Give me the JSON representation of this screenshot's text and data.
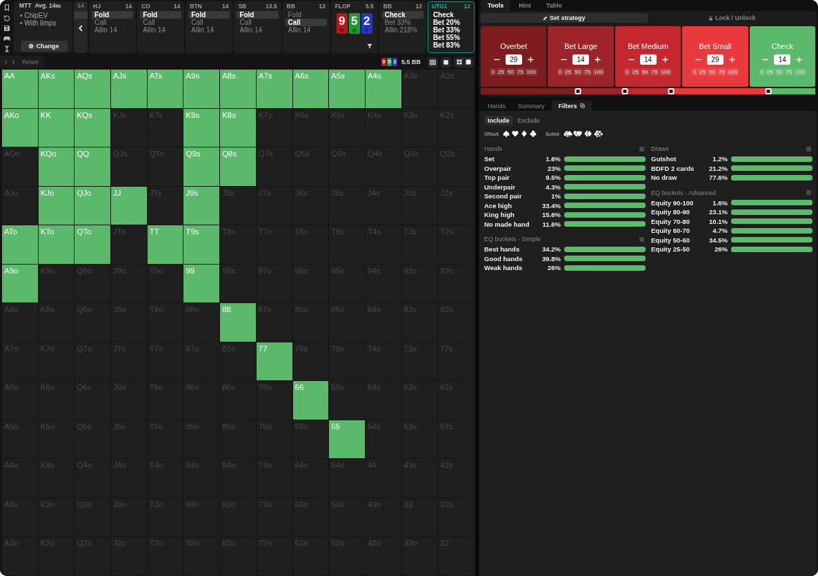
{
  "game_info": {
    "format": "MTT",
    "average": "Avg. 14",
    "average_unit": "bb",
    "options": [
      "• ChipEV",
      "• With limps"
    ],
    "change_button": "Change"
  },
  "collapsed_card": {
    "stack": "14"
  },
  "action_cards": [
    {
      "kind": "position",
      "name": "HJ",
      "amount": "14",
      "active": false,
      "actions": [
        {
          "label": "Fold",
          "selected": true
        },
        {
          "label": "Call",
          "selected": false
        },
        {
          "label": "Allin 14",
          "selected": false
        }
      ]
    },
    {
      "kind": "position",
      "name": "CO",
      "amount": "14",
      "active": false,
      "actions": [
        {
          "label": "Fold",
          "selected": true
        },
        {
          "label": "Call",
          "selected": false
        },
        {
          "label": "Allin 14",
          "selected": false
        }
      ]
    },
    {
      "kind": "position",
      "name": "BTN",
      "amount": "14",
      "active": false,
      "actions": [
        {
          "label": "Fold",
          "selected": true
        },
        {
          "label": "Call",
          "selected": false
        },
        {
          "label": "Allin 14",
          "selected": false
        }
      ]
    },
    {
      "kind": "position",
      "name": "SB",
      "amount": "13.5",
      "active": false,
      "actions": [
        {
          "label": "Fold",
          "selected": true
        },
        {
          "label": "Call",
          "selected": false
        },
        {
          "label": "Allin 14",
          "selected": false
        }
      ]
    },
    {
      "kind": "position",
      "name": "BB",
      "amount": "13",
      "active": false,
      "actions": [
        {
          "label": "Fold",
          "selected": false
        },
        {
          "label": "Call",
          "selected": true
        },
        {
          "label": "Allin 14",
          "selected": false
        }
      ]
    },
    {
      "kind": "board",
      "name": "FLOP",
      "amount": "5.5",
      "active": false,
      "cards": [
        {
          "rank": "9",
          "kind": "heart",
          "color": "#b3191e"
        },
        {
          "rank": "5",
          "kind": "club",
          "color": "#1e9a36"
        },
        {
          "rank": "2",
          "kind": "diamond",
          "color": "#2637c2"
        }
      ]
    },
    {
      "kind": "position",
      "name": "BB",
      "amount": "12",
      "active": false,
      "actions": [
        {
          "label": "Check",
          "selected": true
        },
        {
          "label": "Bet 33%",
          "selected": false
        },
        {
          "label": "Allin 218%",
          "selected": false
        }
      ]
    },
    {
      "kind": "position",
      "name": "UTG1",
      "amount": "12",
      "active": true,
      "actions": [
        {
          "label": "Check",
          "selected": false
        },
        {
          "label": "Bet 20%",
          "selected": false
        },
        {
          "label": "Bet 33%",
          "selected": false
        },
        {
          "label": "Bet 55%",
          "selected": false
        },
        {
          "label": "Bet 83%",
          "selected": false
        }
      ]
    }
  ],
  "toolbar": {
    "reset": "Reset",
    "board": [
      {
        "rank": "9",
        "color": "#c01d22"
      },
      {
        "rank": "5",
        "color": "#20a33a"
      },
      {
        "rank": "2",
        "color": "#2a3bd0"
      }
    ],
    "pot": "5.5 BB"
  },
  "range_grid": {
    "rows": [
      [
        {
          "hand": "AA",
          "highlighted": true
        },
        {
          "hand": "AKs",
          "highlighted": true
        },
        {
          "hand": "AQs",
          "highlighted": true
        },
        {
          "hand": "AJs",
          "highlighted": true
        },
        {
          "hand": "ATs",
          "highlighted": true
        },
        {
          "hand": "A9s",
          "highlighted": true
        },
        {
          "hand": "A8s",
          "highlighted": true
        },
        {
          "hand": "A7s",
          "highlighted": true
        },
        {
          "hand": "A6s",
          "highlighted": true
        },
        {
          "hand": "A5s",
          "highlighted": true
        },
        {
          "hand": "A4s",
          "highlighted": true
        },
        {
          "hand": "A3s",
          "highlighted": false
        },
        {
          "hand": "A2s",
          "highlighted": false
        }
      ],
      [
        {
          "hand": "AKo",
          "highlighted": true
        },
        {
          "hand": "KK",
          "highlighted": true
        },
        {
          "hand": "KQs",
          "highlighted": true
        },
        {
          "hand": "KJs",
          "highlighted": false
        },
        {
          "hand": "KTs",
          "highlighted": false
        },
        {
          "hand": "K9s",
          "highlighted": true
        },
        {
          "hand": "K8s",
          "highlighted": true
        },
        {
          "hand": "K7s",
          "highlighted": false
        },
        {
          "hand": "K6s",
          "highlighted": false
        },
        {
          "hand": "K5s",
          "highlighted": false
        },
        {
          "hand": "K4s",
          "highlighted": false
        },
        {
          "hand": "K3s",
          "highlighted": false
        },
        {
          "hand": "K2s",
          "highlighted": false
        }
      ],
      [
        {
          "hand": "AQo",
          "highlighted": false
        },
        {
          "hand": "KQo",
          "highlighted": true
        },
        {
          "hand": "QQ",
          "highlighted": true
        },
        {
          "hand": "QJs",
          "highlighted": false
        },
        {
          "hand": "QTs",
          "highlighted": false
        },
        {
          "hand": "Q9s",
          "highlighted": true
        },
        {
          "hand": "Q8s",
          "highlighted": true
        },
        {
          "hand": "Q7s",
          "highlighted": false
        },
        {
          "hand": "Q6s",
          "highlighted": false
        },
        {
          "hand": "Q5s",
          "highlighted": false
        },
        {
          "hand": "Q4s",
          "highlighted": false
        },
        {
          "hand": "Q3s",
          "highlighted": false
        },
        {
          "hand": "Q2s",
          "highlighted": false
        }
      ],
      [
        {
          "hand": "AJo",
          "highlighted": false
        },
        {
          "hand": "KJo",
          "highlighted": true
        },
        {
          "hand": "QJo",
          "highlighted": true
        },
        {
          "hand": "JJ",
          "highlighted": true
        },
        {
          "hand": "JTs",
          "highlighted": false
        },
        {
          "hand": "J9s",
          "highlighted": true
        },
        {
          "hand": "J8s",
          "highlighted": false
        },
        {
          "hand": "J7s",
          "highlighted": false
        },
        {
          "hand": "J6s",
          "highlighted": false
        },
        {
          "hand": "J5s",
          "highlighted": false
        },
        {
          "hand": "J4s",
          "highlighted": false
        },
        {
          "hand": "J3s",
          "highlighted": false
        },
        {
          "hand": "J2s",
          "highlighted": false
        }
      ],
      [
        {
          "hand": "ATo",
          "highlighted": true
        },
        {
          "hand": "KTo",
          "highlighted": true
        },
        {
          "hand": "QTo",
          "highlighted": true
        },
        {
          "hand": "JTo",
          "highlighted": false
        },
        {
          "hand": "TT",
          "highlighted": true
        },
        {
          "hand": "T9s",
          "highlighted": true
        },
        {
          "hand": "T8s",
          "highlighted": false
        },
        {
          "hand": "T7s",
          "highlighted": false
        },
        {
          "hand": "T6s",
          "highlighted": false
        },
        {
          "hand": "T5s",
          "highlighted": false
        },
        {
          "hand": "T4s",
          "highlighted": false
        },
        {
          "hand": "T3s",
          "highlighted": false
        },
        {
          "hand": "T2s",
          "highlighted": false
        }
      ],
      [
        {
          "hand": "A9o",
          "highlighted": true
        },
        {
          "hand": "K9o",
          "highlighted": false
        },
        {
          "hand": "Q9o",
          "highlighted": false
        },
        {
          "hand": "J9o",
          "highlighted": false
        },
        {
          "hand": "T9o",
          "highlighted": false
        },
        {
          "hand": "99",
          "highlighted": true
        },
        {
          "hand": "98s",
          "highlighted": false
        },
        {
          "hand": "97s",
          "highlighted": false
        },
        {
          "hand": "96s",
          "highlighted": false
        },
        {
          "hand": "95s",
          "highlighted": false
        },
        {
          "hand": "94s",
          "highlighted": false
        },
        {
          "hand": "93s",
          "highlighted": false
        },
        {
          "hand": "92s",
          "highlighted": false
        }
      ],
      [
        {
          "hand": "A8o",
          "highlighted": false
        },
        {
          "hand": "K8o",
          "highlighted": false
        },
        {
          "hand": "Q8o",
          "highlighted": false
        },
        {
          "hand": "J8o",
          "highlighted": false
        },
        {
          "hand": "T8o",
          "highlighted": false
        },
        {
          "hand": "98o",
          "highlighted": false
        },
        {
          "hand": "88",
          "highlighted": true
        },
        {
          "hand": "87s",
          "highlighted": false
        },
        {
          "hand": "86s",
          "highlighted": false
        },
        {
          "hand": "85s",
          "highlighted": false
        },
        {
          "hand": "84s",
          "highlighted": false
        },
        {
          "hand": "83s",
          "highlighted": false
        },
        {
          "hand": "82s",
          "highlighted": false
        }
      ],
      [
        {
          "hand": "A7o",
          "highlighted": false
        },
        {
          "hand": "K7o",
          "highlighted": false
        },
        {
          "hand": "Q7o",
          "highlighted": false
        },
        {
          "hand": "J7o",
          "highlighted": false
        },
        {
          "hand": "T7o",
          "highlighted": false
        },
        {
          "hand": "97o",
          "highlighted": false
        },
        {
          "hand": "87o",
          "highlighted": false
        },
        {
          "hand": "77",
          "highlighted": true
        },
        {
          "hand": "76s",
          "highlighted": false
        },
        {
          "hand": "75s",
          "highlighted": false
        },
        {
          "hand": "74s",
          "highlighted": false
        },
        {
          "hand": "73s",
          "highlighted": false
        },
        {
          "hand": "72s",
          "highlighted": false
        }
      ],
      [
        {
          "hand": "A6o",
          "highlighted": false
        },
        {
          "hand": "K6o",
          "highlighted": false
        },
        {
          "hand": "Q6o",
          "highlighted": false
        },
        {
          "hand": "J6o",
          "highlighted": false
        },
        {
          "hand": "T6o",
          "highlighted": false
        },
        {
          "hand": "96o",
          "highlighted": false
        },
        {
          "hand": "86o",
          "highlighted": false
        },
        {
          "hand": "76o",
          "highlighted": false
        },
        {
          "hand": "66",
          "highlighted": true
        },
        {
          "hand": "65s",
          "highlighted": false
        },
        {
          "hand": "64s",
          "highlighted": false
        },
        {
          "hand": "63s",
          "highlighted": false
        },
        {
          "hand": "62s",
          "highlighted": false
        }
      ],
      [
        {
          "hand": "A5o",
          "highlighted": false
        },
        {
          "hand": "K5o",
          "highlighted": false
        },
        {
          "hand": "Q5o",
          "highlighted": false
        },
        {
          "hand": "J5o",
          "highlighted": false
        },
        {
          "hand": "T5o",
          "highlighted": false
        },
        {
          "hand": "95o",
          "highlighted": false
        },
        {
          "hand": "85o",
          "highlighted": false
        },
        {
          "hand": "75o",
          "highlighted": false
        },
        {
          "hand": "65o",
          "highlighted": false
        },
        {
          "hand": "55",
          "highlighted": true
        },
        {
          "hand": "54s",
          "highlighted": false
        },
        {
          "hand": "53s",
          "highlighted": false
        },
        {
          "hand": "52s",
          "highlighted": false
        }
      ],
      [
        {
          "hand": "A4o",
          "highlighted": false
        },
        {
          "hand": "K4o",
          "highlighted": false
        },
        {
          "hand": "Q4o",
          "highlighted": false
        },
        {
          "hand": "J4o",
          "highlighted": false
        },
        {
          "hand": "T4o",
          "highlighted": false
        },
        {
          "hand": "94o",
          "highlighted": false
        },
        {
          "hand": "84o",
          "highlighted": false
        },
        {
          "hand": "74o",
          "highlighted": false
        },
        {
          "hand": "64o",
          "highlighted": false
        },
        {
          "hand": "54o",
          "highlighted": false
        },
        {
          "hand": "44",
          "highlighted": false
        },
        {
          "hand": "43s",
          "highlighted": false
        },
        {
          "hand": "42s",
          "highlighted": false
        }
      ],
      [
        {
          "hand": "A3o",
          "highlighted": false
        },
        {
          "hand": "K3o",
          "highlighted": false
        },
        {
          "hand": "Q3o",
          "highlighted": false
        },
        {
          "hand": "J3o",
          "highlighted": false
        },
        {
          "hand": "T3o",
          "highlighted": false
        },
        {
          "hand": "93o",
          "highlighted": false
        },
        {
          "hand": "83o",
          "highlighted": false
        },
        {
          "hand": "73o",
          "highlighted": false
        },
        {
          "hand": "63o",
          "highlighted": false
        },
        {
          "hand": "53o",
          "highlighted": false
        },
        {
          "hand": "43o",
          "highlighted": false
        },
        {
          "hand": "33",
          "highlighted": false
        },
        {
          "hand": "32s",
          "highlighted": false
        }
      ],
      [
        {
          "hand": "A2o",
          "highlighted": false
        },
        {
          "hand": "K2o",
          "highlighted": false
        },
        {
          "hand": "Q2o",
          "highlighted": false
        },
        {
          "hand": "J2o",
          "highlighted": false
        },
        {
          "hand": "T2o",
          "highlighted": false
        },
        {
          "hand": "92o",
          "highlighted": false
        },
        {
          "hand": "82o",
          "highlighted": false
        },
        {
          "hand": "72o",
          "highlighted": false
        },
        {
          "hand": "62o",
          "highlighted": false
        },
        {
          "hand": "52o",
          "highlighted": false
        },
        {
          "hand": "42o",
          "highlighted": false
        },
        {
          "hand": "32o",
          "highlighted": false
        },
        {
          "hand": "22",
          "highlighted": false
        }
      ]
    ]
  },
  "tool_tabs": [
    {
      "label": "Tools",
      "selected": true
    },
    {
      "label": "Hint",
      "selected": false
    },
    {
      "label": "Table",
      "selected": false
    }
  ],
  "mode_buttons": [
    {
      "label": "Set strategy",
      "selected": true
    },
    {
      "label": "Lock / Unlock",
      "selected": false
    }
  ],
  "strategy": {
    "actions": [
      {
        "name": "Overbet",
        "value": "29",
        "color": "#7c1c1e",
        "presets": [
          "0",
          "25",
          "50",
          "75",
          "100"
        ]
      },
      {
        "name": "Bet Large",
        "value": "14",
        "color": "#9c2327",
        "presets": [
          "0",
          "25",
          "50",
          "75",
          "100"
        ]
      },
      {
        "name": "Bet Medium",
        "value": "14",
        "color": "#c4272d",
        "presets": [
          "0",
          "25",
          "50",
          "75",
          "100"
        ]
      },
      {
        "name": "Bet Small",
        "value": "29",
        "color": "#ea393d",
        "presets": [
          "0",
          "25",
          "50",
          "75",
          "100"
        ]
      },
      {
        "name": "Check",
        "value": "14",
        "color": "#5cb86a",
        "presets": [
          "0",
          "25",
          "50",
          "75",
          "100"
        ]
      }
    ],
    "slider": {
      "handles": [
        {
          "level": 0.29
        },
        {
          "level": 0.43
        },
        {
          "level": 0.57
        },
        {
          "level": 0.86
        }
      ]
    }
  },
  "panel_tabs": [
    {
      "label": "Hands",
      "selected": false
    },
    {
      "label": "Summary",
      "selected": false
    },
    {
      "label": "Filters",
      "selected": true
    }
  ],
  "filters": {
    "modes": [
      {
        "label": "Include",
        "selected": true
      },
      {
        "label": "Exclude",
        "selected": false
      }
    ],
    "offsuit_label": "Offsuit",
    "suited_label": "Suited",
    "columns": [
      [
        {
          "title": "Hands",
          "checked": false,
          "rows": [
            {
              "label": "Set",
              "value": "1.6%",
              "level": 1
            },
            {
              "label": "Overpair",
              "value": "23%",
              "level": 1
            },
            {
              "label": "Top pair",
              "value": "9.5%",
              "level": 1
            },
            {
              "label": "Underpair",
              "value": "4.3%",
              "level": 1
            },
            {
              "label": "Second pair",
              "value": "1%",
              "level": 1
            },
            {
              "label": "Ace high",
              "value": "33.4%",
              "level": 1
            },
            {
              "label": "King high",
              "value": "15.6%",
              "level": 1
            },
            {
              "label": "No made hand",
              "value": "11.6%",
              "level": 1
            }
          ]
        },
        {
          "title": "EQ buckets - Simple",
          "checked": false,
          "rows": [
            {
              "label": "Best hands",
              "value": "34.2%",
              "level": 1
            },
            {
              "label": "Good hands",
              "value": "39.8%",
              "level": 1
            },
            {
              "label": "Weak hands",
              "value": "26%",
              "level": 1
            }
          ]
        }
      ],
      [
        {
          "title": "Draws",
          "checked": false,
          "rows": [
            {
              "label": "Gutshot",
              "value": "1.2%",
              "level": 1
            },
            {
              "label": "BDFD 2 cards",
              "value": "21.2%",
              "level": 1
            },
            {
              "label": "No draw",
              "value": "77.6%",
              "level": 1
            }
          ]
        },
        {
          "title": "EQ buckets - Advanced",
          "checked": false,
          "rows": [
            {
              "label": "Equity 90-100",
              "value": "1.6%",
              "level": 1
            },
            {
              "label": "Equity 80-90",
              "value": "23.1%",
              "level": 1
            },
            {
              "label": "Equity 70-80",
              "value": "10.1%",
              "level": 1
            },
            {
              "label": "Equity 60-70",
              "value": "4.7%",
              "level": 1
            },
            {
              "label": "Equity 50-60",
              "value": "34.5%",
              "level": 1
            },
            {
              "label": "Equity 25-50",
              "value": "26%",
              "level": 1
            }
          ]
        }
      ]
    ]
  }
}
